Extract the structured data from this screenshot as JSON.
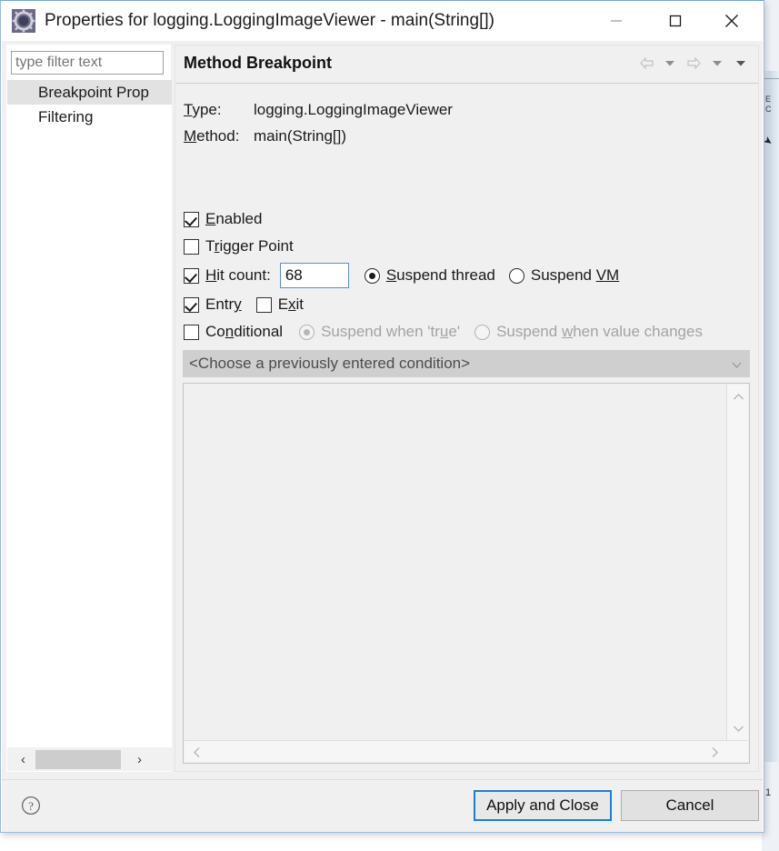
{
  "window": {
    "title": "Properties for logging.LoggingImageViewer - main(String[])",
    "icon": "gear-icon",
    "controls": {
      "minimize": "minimize-icon",
      "maximize": "maximize-icon",
      "close": "close-icon"
    }
  },
  "sidebar": {
    "filter": {
      "placeholder": "type filter text",
      "value": ""
    },
    "items": [
      {
        "label": "Breakpoint Prop",
        "selected": true
      },
      {
        "label": "Filtering",
        "selected": false
      }
    ],
    "scrollbar": {
      "left_arrow": "‹",
      "right_arrow": "›"
    }
  },
  "page": {
    "title": "Method Breakpoint",
    "nav": {
      "back": "back-arrow-icon",
      "back_menu": "chevron-down-icon",
      "forward": "forward-arrow-icon",
      "forward_menu": "chevron-down-icon",
      "view_menu": "chevron-down-icon"
    },
    "info": {
      "type_label": "Type:",
      "type_mnemonic": "T",
      "type_rest": "ype:",
      "type_value": "logging.LoggingImageViewer",
      "method_label": "Method:",
      "method_mnemonic": "M",
      "method_rest": "ethod:",
      "method_value": "main(String[])"
    },
    "options": {
      "enabled": {
        "label_mnemonic": "E",
        "label_rest": "nabled",
        "checked": true
      },
      "trigger_point": {
        "label_pre": "T",
        "label_mnemonic": "r",
        "label_rest": "igger Point",
        "checked": false
      },
      "hit_count": {
        "label_mnemonic": "H",
        "label_rest": "it count:",
        "checked": true,
        "value": "68"
      },
      "entry": {
        "label_pre": "Entr",
        "label_mnemonic": "y",
        "checked": true
      },
      "exit": {
        "label_pre": "E",
        "label_mnemonic": "x",
        "label_rest": "it",
        "checked": false
      },
      "conditional": {
        "label_pre": "Co",
        "label_mnemonic": "n",
        "label_rest": "ditional",
        "checked": false,
        "enabled": false
      }
    },
    "suspend_policy": {
      "thread": {
        "label_mnemonic": "S",
        "label_rest": "uspend thread",
        "selected": true
      },
      "vm": {
        "label_pre": "Suspend ",
        "label_mnemonic": "VM",
        "selected": false
      }
    },
    "condition_mode": {
      "suspend_true": {
        "label_pre": "Suspend when 'tr",
        "label_mnemonic": "u",
        "label_rest": "e'",
        "selected": true,
        "enabled": false
      },
      "suspend_change": {
        "label_pre": "Suspend ",
        "label_mnemonic": "w",
        "label_rest": "hen value changes",
        "selected": false,
        "enabled": false
      }
    },
    "condition_combo": {
      "value": "<Choose a previously entered condition>",
      "arrow": "chevron-down-icon",
      "enabled": false
    },
    "condition_editor": {
      "value": "",
      "vscroll": {
        "up": "˄",
        "down": "˅"
      },
      "hscroll": {
        "left": "‹",
        "right": "›"
      }
    }
  },
  "footer": {
    "help": "help-icon",
    "apply_label": "Apply and Close",
    "cancel_label": "Cancel"
  },
  "colors": {
    "accent": "#1b7fd4",
    "dialog_border": "#9bbbdb",
    "panel_bg": "#f0f0f0",
    "selection": "#e2e2e2"
  }
}
